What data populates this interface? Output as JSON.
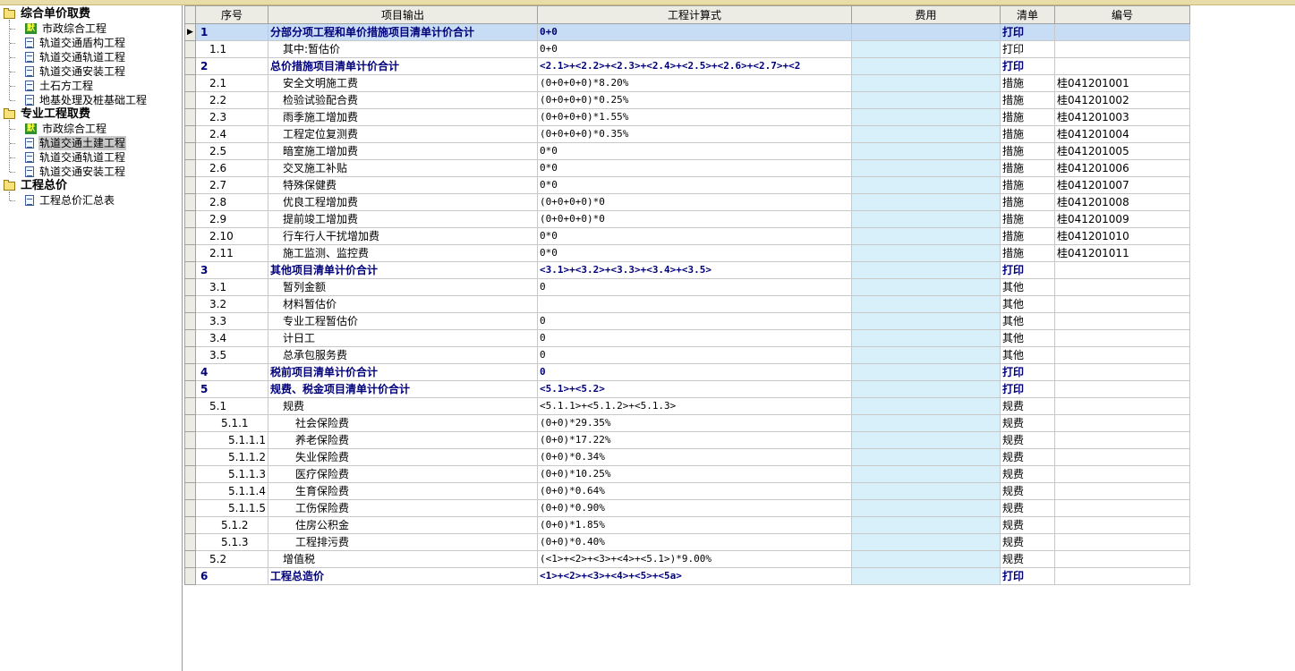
{
  "tree": {
    "groups": [
      {
        "label": "综合单价取费",
        "items": [
          {
            "label": "市政综合工程",
            "icon": "default",
            "selected": false
          },
          {
            "label": "轨道交通盾构工程",
            "icon": "doc",
            "selected": false
          },
          {
            "label": "轨道交通轨道工程",
            "icon": "doc",
            "selected": false
          },
          {
            "label": "轨道交通安装工程",
            "icon": "doc",
            "selected": false
          },
          {
            "label": "土石方工程",
            "icon": "doc",
            "selected": false
          },
          {
            "label": "地基处理及桩基础工程",
            "icon": "doc",
            "selected": false
          }
        ]
      },
      {
        "label": "专业工程取费",
        "items": [
          {
            "label": "市政综合工程",
            "icon": "default",
            "selected": false
          },
          {
            "label": "轨道交通土建工程",
            "icon": "doc",
            "selected": true
          },
          {
            "label": "轨道交通轨道工程",
            "icon": "doc",
            "selected": false
          },
          {
            "label": "轨道交通安装工程",
            "icon": "doc",
            "selected": false
          }
        ]
      },
      {
        "label": "工程总价",
        "items": [
          {
            "label": "工程总价汇总表",
            "icon": "doc",
            "selected": false
          }
        ]
      }
    ],
    "default_icon_text": "默"
  },
  "table": {
    "columns": [
      "序号",
      "项目输出",
      "工程计算式",
      "费用",
      "清单",
      "编号"
    ],
    "rows": [
      {
        "seq": "1",
        "name": "分部分项工程和单价措施项目清单计价合计",
        "formula": "0+0",
        "fee": "",
        "list": "打印",
        "code": "",
        "bold": true,
        "selected": true,
        "indent": 0,
        "pointer": true
      },
      {
        "seq": "1.1",
        "name": "其中:暂估价",
        "formula": "0+0",
        "fee": "",
        "list": "打印",
        "code": "",
        "bold": false,
        "indent": 1
      },
      {
        "seq": "2",
        "name": "总价措施项目清单计价合计",
        "formula": "<2.1>+<2.2>+<2.3>+<2.4>+<2.5>+<2.6>+<2.7>+<2",
        "fee": "",
        "list": "打印",
        "code": "",
        "bold": true,
        "indent": 0
      },
      {
        "seq": "2.1",
        "name": "安全文明施工费",
        "formula": "(0+0+0+0)*8.20%",
        "fee": "",
        "list": "措施",
        "code": "桂041201001",
        "bold": false,
        "indent": 1
      },
      {
        "seq": "2.2",
        "name": "检验试验配合费",
        "formula": "(0+0+0+0)*0.25%",
        "fee": "",
        "list": "措施",
        "code": "桂041201002",
        "bold": false,
        "indent": 1
      },
      {
        "seq": "2.3",
        "name": "雨季施工增加费",
        "formula": "(0+0+0+0)*1.55%",
        "fee": "",
        "list": "措施",
        "code": "桂041201003",
        "bold": false,
        "indent": 1
      },
      {
        "seq": "2.4",
        "name": "工程定位复测费",
        "formula": "(0+0+0+0)*0.35%",
        "fee": "",
        "list": "措施",
        "code": "桂041201004",
        "bold": false,
        "indent": 1
      },
      {
        "seq": "2.5",
        "name": "暗室施工增加费",
        "formula": "0*0",
        "fee": "",
        "list": "措施",
        "code": "桂041201005",
        "bold": false,
        "indent": 1
      },
      {
        "seq": "2.6",
        "name": "交叉施工补贴",
        "formula": "0*0",
        "fee": "",
        "list": "措施",
        "code": "桂041201006",
        "bold": false,
        "indent": 1
      },
      {
        "seq": "2.7",
        "name": "特殊保健费",
        "formula": "0*0",
        "fee": "",
        "list": "措施",
        "code": "桂041201007",
        "bold": false,
        "indent": 1
      },
      {
        "seq": "2.8",
        "name": "优良工程增加费",
        "formula": "(0+0+0+0)*0",
        "fee": "",
        "list": "措施",
        "code": "桂041201008",
        "bold": false,
        "indent": 1
      },
      {
        "seq": "2.9",
        "name": "提前竣工增加费",
        "formula": "(0+0+0+0)*0",
        "fee": "",
        "list": "措施",
        "code": "桂041201009",
        "bold": false,
        "indent": 1
      },
      {
        "seq": "2.10",
        "name": "行车行人干扰增加费",
        "formula": "0*0",
        "fee": "",
        "list": "措施",
        "code": "桂041201010",
        "bold": false,
        "indent": 1
      },
      {
        "seq": "2.11",
        "name": "施工监测、监控费",
        "formula": "0*0",
        "fee": "",
        "list": "措施",
        "code": "桂041201011",
        "bold": false,
        "indent": 1
      },
      {
        "seq": "3",
        "name": "其他项目清单计价合计",
        "formula": "<3.1>+<3.2>+<3.3>+<3.4>+<3.5>",
        "fee": "",
        "list": "打印",
        "code": "",
        "bold": true,
        "indent": 0
      },
      {
        "seq": "3.1",
        "name": "暂列金额",
        "formula": "0",
        "fee": "",
        "list": "其他",
        "code": "",
        "bold": false,
        "indent": 1
      },
      {
        "seq": "3.2",
        "name": "材料暂估价",
        "formula": "",
        "fee": "",
        "list": "其他",
        "code": "",
        "bold": false,
        "indent": 1
      },
      {
        "seq": "3.3",
        "name": "专业工程暂估价",
        "formula": "0",
        "fee": "",
        "list": "其他",
        "code": "",
        "bold": false,
        "indent": 1
      },
      {
        "seq": "3.4",
        "name": "计日工",
        "formula": "0",
        "fee": "",
        "list": "其他",
        "code": "",
        "bold": false,
        "indent": 1
      },
      {
        "seq": "3.5",
        "name": "总承包服务费",
        "formula": "0",
        "fee": "",
        "list": "其他",
        "code": "",
        "bold": false,
        "indent": 1
      },
      {
        "seq": "4",
        "name": "税前项目清单计价合计",
        "formula": "0",
        "fee": "",
        "list": "打印",
        "code": "",
        "bold": true,
        "indent": 0
      },
      {
        "seq": "5",
        "name": "规费、税金项目清单计价合计",
        "formula": "<5.1>+<5.2>",
        "fee": "",
        "list": "打印",
        "code": "",
        "bold": true,
        "indent": 0
      },
      {
        "seq": "5.1",
        "name": "规费",
        "formula": "<5.1.1>+<5.1.2>+<5.1.3>",
        "fee": "",
        "list": "规费",
        "code": "",
        "bold": false,
        "indent": 1
      },
      {
        "seq": "5.1.1",
        "name": "社会保险费",
        "formula": "(0+0)*29.35%",
        "fee": "",
        "list": "规费",
        "code": "",
        "bold": false,
        "indent": 2
      },
      {
        "seq": "5.1.1.1",
        "name": "养老保险费",
        "formula": "(0+0)*17.22%",
        "fee": "",
        "list": "规费",
        "code": "",
        "bold": false,
        "indent": 2
      },
      {
        "seq": "5.1.1.2",
        "name": "失业保险费",
        "formula": "(0+0)*0.34%",
        "fee": "",
        "list": "规费",
        "code": "",
        "bold": false,
        "indent": 2
      },
      {
        "seq": "5.1.1.3",
        "name": "医疗保险费",
        "formula": "(0+0)*10.25%",
        "fee": "",
        "list": "规费",
        "code": "",
        "bold": false,
        "indent": 2
      },
      {
        "seq": "5.1.1.4",
        "name": "生育保险费",
        "formula": "(0+0)*0.64%",
        "fee": "",
        "list": "规费",
        "code": "",
        "bold": false,
        "indent": 2
      },
      {
        "seq": "5.1.1.5",
        "name": "工伤保险费",
        "formula": "(0+0)*0.90%",
        "fee": "",
        "list": "规费",
        "code": "",
        "bold": false,
        "indent": 2
      },
      {
        "seq": "5.1.2",
        "name": "住房公积金",
        "formula": "(0+0)*1.85%",
        "fee": "",
        "list": "规费",
        "code": "",
        "bold": false,
        "indent": 2
      },
      {
        "seq": "5.1.3",
        "name": "工程排污费",
        "formula": "(0+0)*0.40%",
        "fee": "",
        "list": "规费",
        "code": "",
        "bold": false,
        "indent": 2
      },
      {
        "seq": "5.2",
        "name": "增值税",
        "formula": "(<1>+<2>+<3>+<4>+<5.1>)*9.00%",
        "fee": "",
        "list": "规费",
        "code": "",
        "bold": false,
        "indent": 1
      },
      {
        "seq": "6",
        "name": "工程总造价",
        "formula": "<1>+<2>+<3>+<4>+<5>+<5a>",
        "fee": "",
        "list": "打印",
        "code": "",
        "bold": true,
        "indent": 0
      }
    ]
  }
}
